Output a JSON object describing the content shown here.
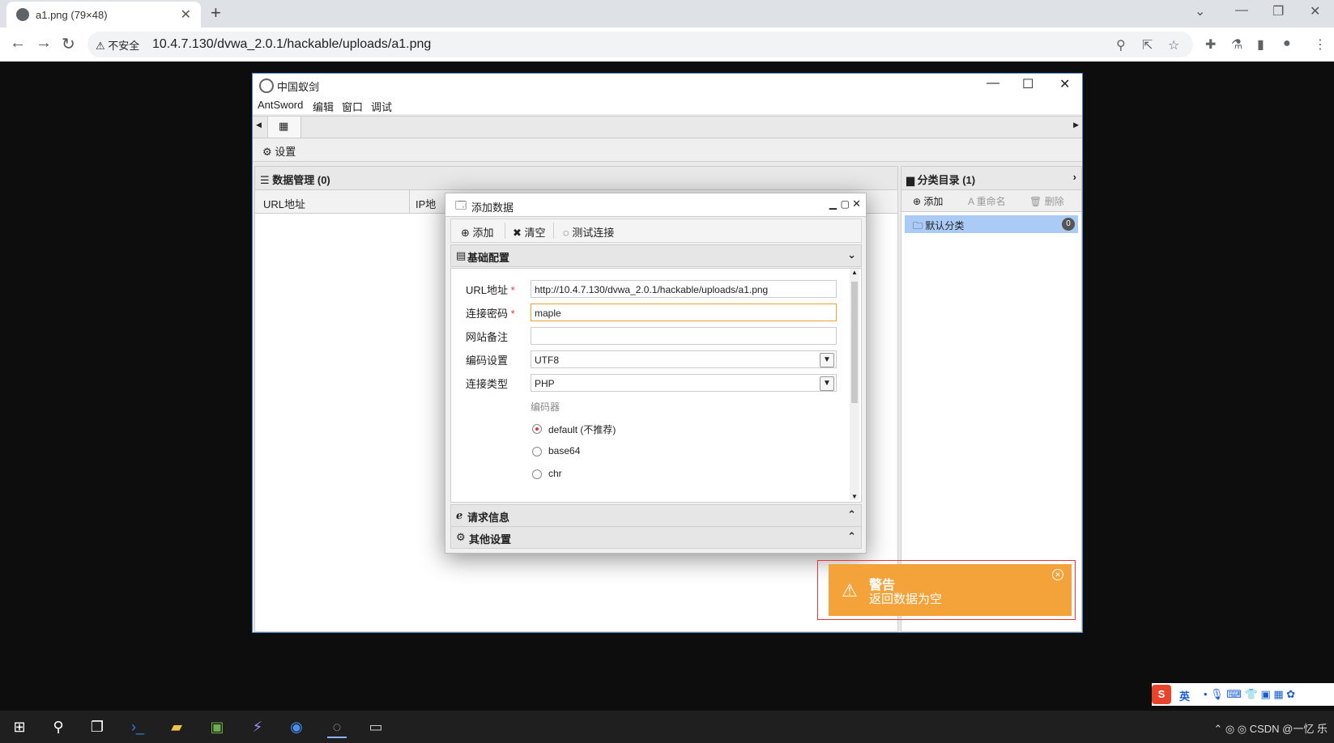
{
  "browser": {
    "tab_title": "a1.png (79×48)",
    "new_tab": "+",
    "security_label": "⚠ 不安全",
    "url": "10.4.7.130/dvwa_2.0.1/hackable/uploads/a1.png"
  },
  "app": {
    "title": "中国蚁剑",
    "menu": [
      "AntSword",
      "编辑",
      "窗口",
      "调试"
    ],
    "settings_label": "⚙ 设置",
    "data_panel_title": "☰ 数据管理 (0)",
    "columns": [
      "URL地址",
      "IP地"
    ],
    "category_title": "▆ 分类目录 (1)",
    "category_toolbar": [
      "⊕ 添加",
      "A 重命名",
      "🗑 删除"
    ],
    "category_item": "🗀 默认分类",
    "category_count": "0"
  },
  "dialog": {
    "title": "添加数据",
    "toolbar": [
      "⊕ 添加",
      "✖ 清空",
      "◌ 测试连接"
    ],
    "section_basic": "基础配置",
    "section_request": "请求信息",
    "section_other": "其他设置",
    "fields": {
      "url_label": "URL地址",
      "url_value": "http://10.4.7.130/dvwa_2.0.1/hackable/uploads/a1.png",
      "password_label": "连接密码",
      "password_value": "maple",
      "note_label": "网站备注",
      "note_value": "",
      "encoding_label": "编码设置",
      "encoding_value": "UTF8",
      "type_label": "连接类型",
      "type_value": "PHP",
      "encoder_label": "编码器",
      "encoders": [
        "default (不推荐)",
        "base64",
        "chr"
      ],
      "required_mark": "*"
    }
  },
  "toast": {
    "title": "警告",
    "message": "返回数据为空",
    "color": "#f4a33b"
  },
  "ime": {
    "lang": "英",
    "text": "CSDN @一忆 乐"
  }
}
